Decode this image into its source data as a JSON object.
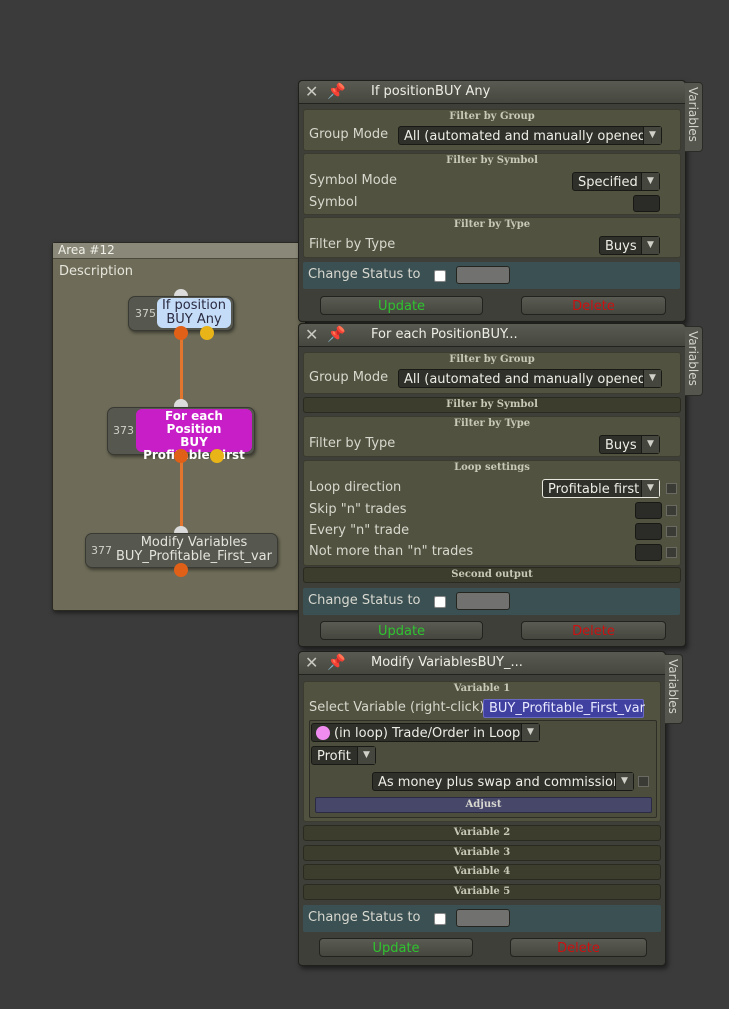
{
  "area": {
    "title": "Area #12",
    "description": "Description",
    "nodes": [
      {
        "number": "375",
        "label": "If position\nBUY Any"
      },
      {
        "number": "373",
        "label": "For each Position\nBUY\nProfitable First"
      },
      {
        "number": "377",
        "label": "Modify Variables\nBUY_Profitable_First_var"
      }
    ]
  },
  "variables_tab": "Variables",
  "panel1": {
    "title": "If positionBUY Any",
    "filter_group_header": "Filter by Group",
    "group_mode_label": "Group Mode",
    "group_mode_value": "All (automated and manually opened)",
    "filter_symbol_header": "Filter by Symbol",
    "symbol_mode_label": "Symbol Mode",
    "symbol_mode_value": "Specified",
    "symbol_label": "Symbol",
    "filter_type_header": "Filter by Type",
    "filter_type_label": "Filter by Type",
    "filter_type_value": "Buys",
    "change_status_label": "Change Status to",
    "update_label": "Update",
    "delete_label": "Delete"
  },
  "panel2": {
    "title": "For each PositionBUY...",
    "filter_group_header": "Filter by Group",
    "group_mode_label": "Group Mode",
    "group_mode_value": "All (automated and manually opened)",
    "filter_symbol_header": "Filter by Symbol",
    "filter_type_header": "Filter by Type",
    "filter_type_label": "Filter by Type",
    "filter_type_value": "Buys",
    "loop_header": "Loop settings",
    "loop_direction_label": "Loop direction",
    "loop_direction_value": "Profitable first",
    "skip_label": "Skip \"n\" trades",
    "every_label": "Every \"n\" trade",
    "not_more_label": "Not more than \"n\" trades",
    "second_output_header": "Second output",
    "change_status_label": "Change Status to",
    "update_label": "Update",
    "delete_label": "Delete"
  },
  "panel3": {
    "title": "Modify VariablesBUY_...",
    "variable1_header": "Variable 1",
    "select_variable_label": "Select Variable (right-click)",
    "select_variable_value": "BUY_Profitable_First_var",
    "source_value": "(in loop) Trade/Order in Loop",
    "field_value": "Profit",
    "mode_value": "As money plus swap and commission",
    "adjust_label": "Adjust",
    "variable2_header": "Variable 2",
    "variable3_header": "Variable 3",
    "variable4_header": "Variable 4",
    "variable5_header": "Variable 5",
    "change_status_label": "Change Status to",
    "update_label": "Update",
    "delete_label": "Delete"
  },
  "colors": {
    "accent_magenta": "#c81ec8",
    "node_blue": "#c4dcf8",
    "update_green": "#2fc42f",
    "delete_red": "#cc1010",
    "connector_orange": "#e2762e"
  }
}
